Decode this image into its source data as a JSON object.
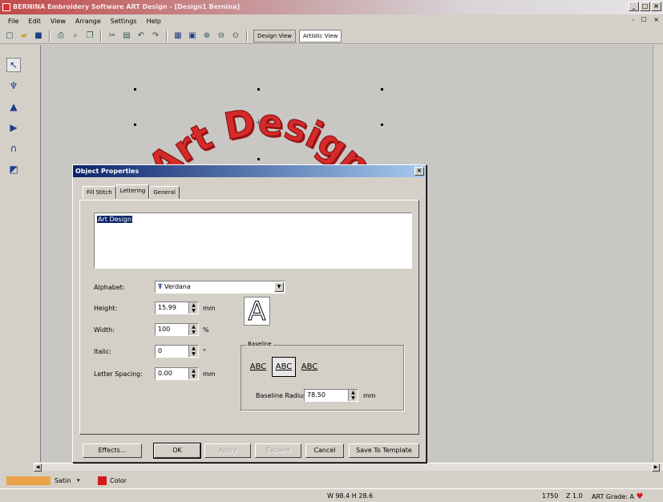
{
  "window": {
    "title": "BERNINA Embroidery Software ART Design - [Design1   Bernina]",
    "min": "_",
    "max": "□",
    "close": "×"
  },
  "menu": {
    "items": [
      "File",
      "Edit",
      "View",
      "Arrange",
      "Settings",
      "Help"
    ],
    "mdi_controls": "- ☐ ×"
  },
  "toolbar": {
    "design_view": "Design View",
    "artistic_view": "Artistic View"
  },
  "canvas": {
    "art_text": "Art Design",
    "art_color": "#d42a2a"
  },
  "dialog": {
    "title": "Object Properties",
    "close": "×",
    "tabs": [
      "Fill Stitch",
      "Lettering",
      "General"
    ],
    "text_value": "Art Design",
    "alphabet": {
      "label": "Alphabet:",
      "value": "Verdana",
      "font_icon": "Ŧ"
    },
    "height": {
      "label": "Height:",
      "value": "15.99",
      "unit": "mm"
    },
    "width": {
      "label": "Width:",
      "value": "100",
      "unit": "%"
    },
    "italic": {
      "label": "Italic:",
      "value": "0",
      "unit": "°"
    },
    "letter_spacing": {
      "label": "Letter Spacing:",
      "value": "0.00",
      "unit": "mm"
    },
    "preview_glyph": "A",
    "baseline": {
      "title": "Baseline",
      "options": [
        "ABC",
        "ABC",
        "ABC"
      ],
      "radius_label": "Baseline Radius:",
      "radius_value": "78.50",
      "radius_unit": "mm"
    },
    "buttons": {
      "effects": "Effects...",
      "ok": "OK",
      "apply": "Apply",
      "expand": "Expand",
      "cancel": "Cancel",
      "save_template": "Save To Template"
    }
  },
  "colorbar": {
    "stitch_type": "Satin",
    "color_label": "Color"
  },
  "status": {
    "dimensions": "W 98.4 H 28.6",
    "stitches": "1750",
    "zoom": "Z 1.0",
    "grade": "ART Grade: A"
  }
}
